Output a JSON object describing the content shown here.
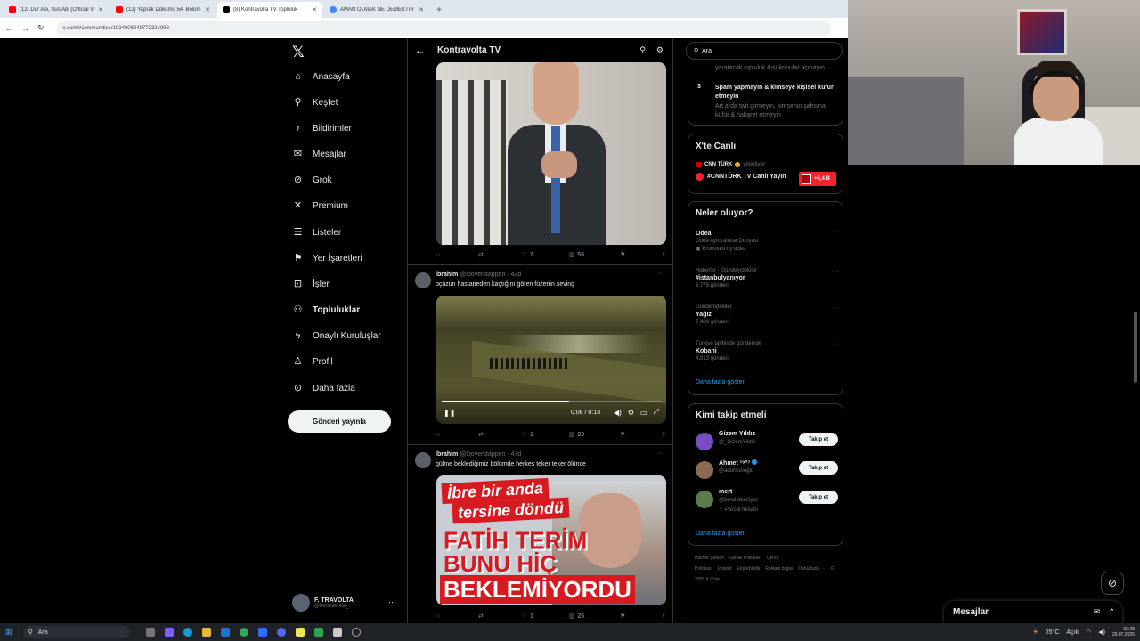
{
  "browser": {
    "tabs": [
      {
        "title": "(12) Dur Abi, Sus Abi (Official V",
        "icon": "youtube-icon",
        "color": "#ff0000"
      },
      {
        "title": "(12) Yaprak Dökümü 54. Bölüm",
        "icon": "youtube-icon",
        "color": "#ff0000"
      },
      {
        "title": "(8) Kontravolta TV Topluluk",
        "icon": "x-icon",
        "color": "#000000"
      },
      {
        "title": "AMAN OLMAK NE DEMEKTİR",
        "icon": "google-icon",
        "color": "#4285f4"
      }
    ],
    "url": "x.com/i/communities/1934008949772324998"
  },
  "nav": {
    "items": [
      {
        "label": "Anasayfa",
        "icon": "home-icon",
        "glyph": "⌂"
      },
      {
        "label": "Keşfet",
        "icon": "search-icon",
        "glyph": "⚲"
      },
      {
        "label": "Bildirimler",
        "icon": "bell-icon",
        "glyph": "♪"
      },
      {
        "label": "Mesajlar",
        "icon": "mail-icon",
        "glyph": "✉"
      },
      {
        "label": "Grok",
        "icon": "grok-icon",
        "glyph": "⊘"
      },
      {
        "label": "Premium",
        "icon": "x-premium-icon",
        "glyph": "✕"
      },
      {
        "label": "Listeler",
        "icon": "list-icon",
        "glyph": "☰"
      },
      {
        "label": "Yer İşaretleri",
        "icon": "bookmark-icon",
        "glyph": "⚑"
      },
      {
        "label": "İşler",
        "icon": "briefcase-icon",
        "glyph": "⊡"
      },
      {
        "label": "Topluluklar",
        "icon": "communities-icon",
        "glyph": "⚇"
      },
      {
        "label": "Onaylı Kuruluşlar",
        "icon": "lightning-icon",
        "glyph": "ϟ"
      },
      {
        "label": "Profil",
        "icon": "person-icon",
        "glyph": "♙"
      },
      {
        "label": "Daha fazla",
        "icon": "more-circle-icon",
        "glyph": "⊙"
      }
    ],
    "post_button": "Gönderi yayınla",
    "account": {
      "name": "F. TRAVOLTA",
      "handle": "@kontravolta_"
    }
  },
  "header": {
    "title": "Kontravolta TV"
  },
  "posts": [
    {
      "author": "",
      "handle": "",
      "time": "",
      "text": "",
      "replies": "",
      "reposts": "",
      "likes": "2",
      "views": "56"
    },
    {
      "author": "İbrahim",
      "handle": "@lboverstappen",
      "time": "43d",
      "text": "oçuzun hastaneden kaçtığını gören füzenin sevinç",
      "replies": "",
      "reposts": "",
      "likes": "1",
      "views": "23",
      "video_time": "0:08 / 0:13",
      "progress": 0.58
    },
    {
      "author": "İbrahim",
      "handle": "@lboverstappen",
      "time": "47d",
      "text": "gülme beklediğimiz bölümde herkes teker teker ölünce",
      "replies": "",
      "reposts": "",
      "likes": "1",
      "views": "25",
      "headline": {
        "l1": "İbre bir anda",
        "l2": "tersine döndü",
        "l3": "FATİH TERİM",
        "l4": "BUNU HİÇ",
        "l5": "BEKLEMİYORDU"
      }
    }
  ],
  "search": {
    "placeholder": "Ara"
  },
  "rules": {
    "r2_tail": "yaratacak topluluk dışı konular açmayın",
    "r3_num": "3",
    "r3_title": "Spam yapmayın & kimseye kişisel küfür etmeyin",
    "r3_desc": "Art arda twit girmeyin, kimsenin şahsına küfür & hakaret etmeyin"
  },
  "live": {
    "title": "X'te Canlı",
    "host": "CNN TÜRK",
    "host_suffix": "yönetiyor",
    "stream": "#CNNTÜRK TV Canlı Yayın",
    "viewers": "+6,4 B"
  },
  "trends": {
    "title": "Neler oluyor?",
    "items": [
      {
        "category": "",
        "name": "Odea",
        "sub": "Odea Aynıcalıklar Dünyası",
        "count": "Promoted by odea"
      },
      {
        "category": "Haberler · Gündemdekiler",
        "name": "#istanbulyanıyor",
        "count": "6.775 gönderi"
      },
      {
        "category": "Gündemdekiler",
        "name": "Yağız",
        "count": "7.489 gönderi"
      },
      {
        "category": "Türkiye tarihinde gündemde",
        "name": "Kobani",
        "count": "4.313 gönderi"
      }
    ],
    "more": "Daha fazla göster"
  },
  "who_to_follow": {
    "title": "Kimi takip etmeli",
    "items": [
      {
        "name": "Gizem Yıldız",
        "handle": "@_GizemYildiz",
        "extra": "",
        "button": "Takip et",
        "avatar": "#7a4cc4"
      },
      {
        "name": "Ahmet ¹⁹⁰⁷",
        "handle": "@adursunoglu",
        "extra": "",
        "button": "Takip et",
        "avatar": "#8b6a50"
      },
      {
        "name": "mert",
        "handle": "@bendrakeclym",
        "extra": "Parodi hesabı",
        "button": "Takip et",
        "avatar": "#5f7a4a"
      }
    ],
    "more": "Daha fazla göster"
  },
  "footer": {
    "links": [
      "Hizmet Şartları",
      "Gizlilik Politikası",
      "Çerez Politikası",
      "Imprint",
      "Erişilebilirlik",
      "Reklam bilgisi",
      "Daha fazla ···",
      "© 2025 X Corp."
    ]
  },
  "messages": {
    "title": "Mesajlar"
  },
  "taskbar": {
    "search": "Ara",
    "weather": "25°C",
    "weather_desc": "Açık",
    "time": "02:28",
    "date": "29.07.2025"
  }
}
